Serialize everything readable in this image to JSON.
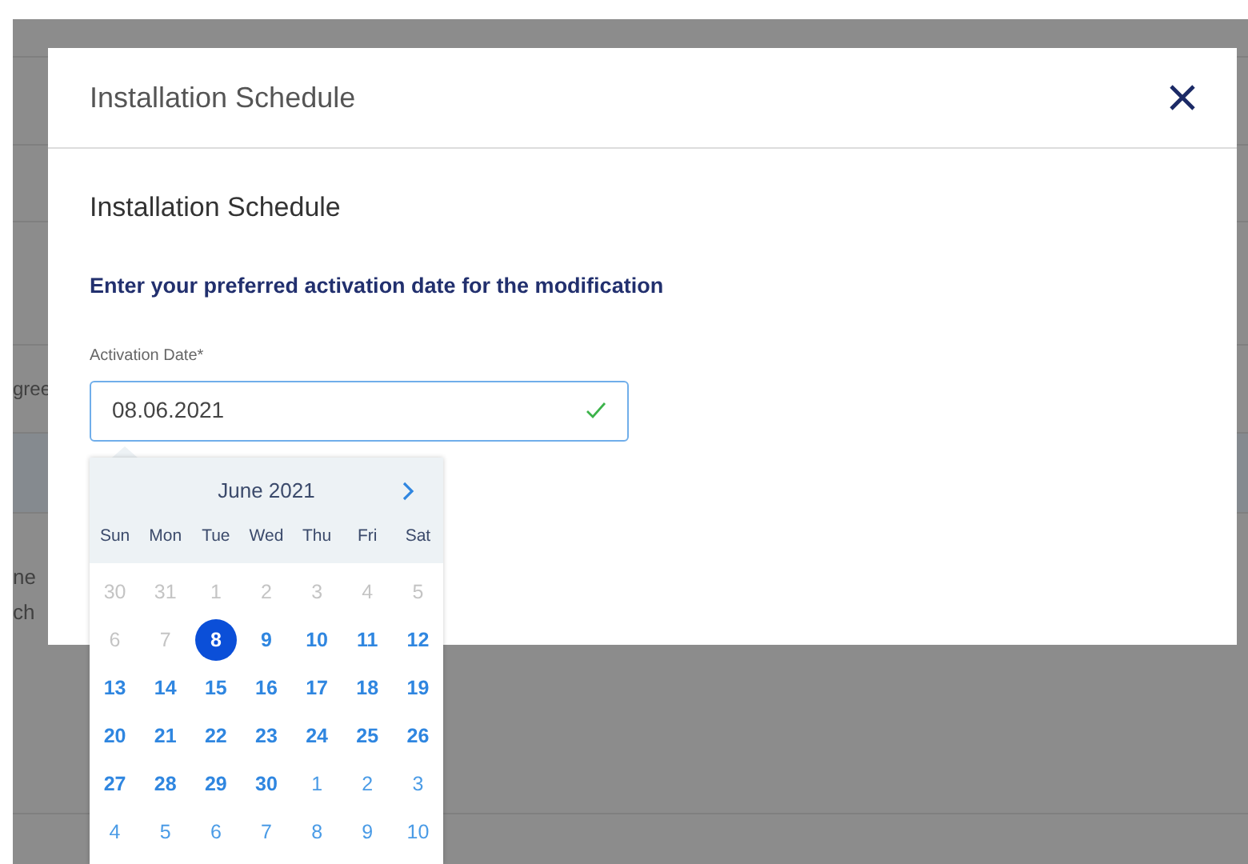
{
  "background": {
    "fragments": [
      "gree",
      "ne",
      "ch"
    ]
  },
  "dialog": {
    "title": "Installation Schedule",
    "heading": "Installation Schedule",
    "instruction": "Enter your preferred activation date for the modification",
    "field": {
      "label": "Activation Date*",
      "value": "08.06.2021",
      "valid": true
    }
  },
  "calendar": {
    "month": "June 2021",
    "weekdays": [
      "Sun",
      "Mon",
      "Tue",
      "Wed",
      "Thu",
      "Fri",
      "Sat"
    ],
    "weeks": [
      [
        {
          "label": "30",
          "kind": "prev",
          "selected": false
        },
        {
          "label": "31",
          "kind": "prev",
          "selected": false
        },
        {
          "label": "1",
          "kind": "prev",
          "selected": false
        },
        {
          "label": "2",
          "kind": "prev",
          "selected": false
        },
        {
          "label": "3",
          "kind": "prev",
          "selected": false
        },
        {
          "label": "4",
          "kind": "prev",
          "selected": false
        },
        {
          "label": "5",
          "kind": "prev",
          "selected": false
        }
      ],
      [
        {
          "label": "6",
          "kind": "prev",
          "selected": false
        },
        {
          "label": "7",
          "kind": "prev",
          "selected": false
        },
        {
          "label": "8",
          "kind": "current",
          "selected": true
        },
        {
          "label": "9",
          "kind": "current",
          "selected": false
        },
        {
          "label": "10",
          "kind": "current",
          "selected": false
        },
        {
          "label": "11",
          "kind": "current",
          "selected": false
        },
        {
          "label": "12",
          "kind": "current",
          "selected": false
        }
      ],
      [
        {
          "label": "13",
          "kind": "current",
          "selected": false
        },
        {
          "label": "14",
          "kind": "current",
          "selected": false
        },
        {
          "label": "15",
          "kind": "current",
          "selected": false
        },
        {
          "label": "16",
          "kind": "current",
          "selected": false
        },
        {
          "label": "17",
          "kind": "current",
          "selected": false
        },
        {
          "label": "18",
          "kind": "current",
          "selected": false
        },
        {
          "label": "19",
          "kind": "current",
          "selected": false
        }
      ],
      [
        {
          "label": "20",
          "kind": "current",
          "selected": false
        },
        {
          "label": "21",
          "kind": "current",
          "selected": false
        },
        {
          "label": "22",
          "kind": "current",
          "selected": false
        },
        {
          "label": "23",
          "kind": "current",
          "selected": false
        },
        {
          "label": "24",
          "kind": "current",
          "selected": false
        },
        {
          "label": "25",
          "kind": "current",
          "selected": false
        },
        {
          "label": "26",
          "kind": "current",
          "selected": false
        }
      ],
      [
        {
          "label": "27",
          "kind": "current",
          "selected": false
        },
        {
          "label": "28",
          "kind": "current",
          "selected": false
        },
        {
          "label": "29",
          "kind": "current",
          "selected": false
        },
        {
          "label": "30",
          "kind": "current",
          "selected": false
        },
        {
          "label": "1",
          "kind": "next",
          "selected": false
        },
        {
          "label": "2",
          "kind": "next",
          "selected": false
        },
        {
          "label": "3",
          "kind": "next",
          "selected": false
        }
      ],
      [
        {
          "label": "4",
          "kind": "next",
          "selected": false
        },
        {
          "label": "5",
          "kind": "next",
          "selected": false
        },
        {
          "label": "6",
          "kind": "next",
          "selected": false
        },
        {
          "label": "7",
          "kind": "next",
          "selected": false
        },
        {
          "label": "8",
          "kind": "next",
          "selected": false
        },
        {
          "label": "9",
          "kind": "next",
          "selected": false
        },
        {
          "label": "10",
          "kind": "next",
          "selected": false
        }
      ]
    ]
  }
}
